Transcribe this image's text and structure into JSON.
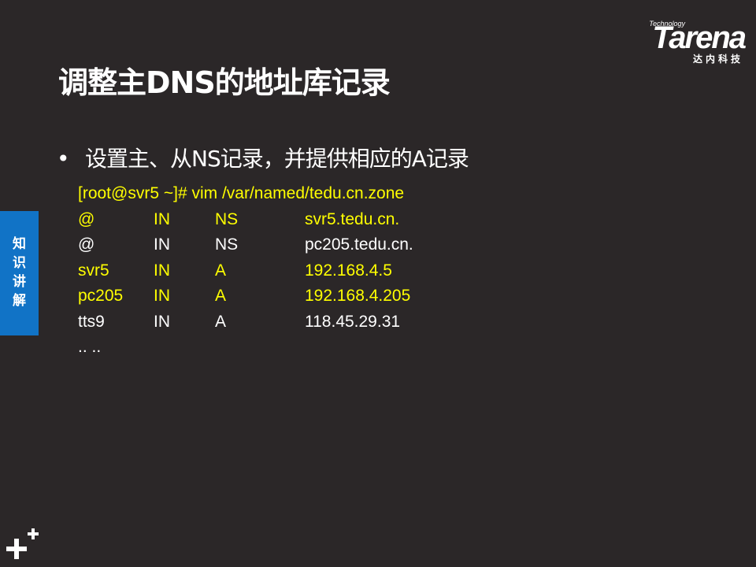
{
  "logo": {
    "technology": "Technology",
    "name": "Tarena",
    "chinese": "达内科技"
  },
  "slide": {
    "title": "调整主DNS的地址库记录",
    "side_tab": "知识讲解",
    "bullet": "设置主、从NS记录，并提供相应的A记录",
    "command": "[root@svr5 ~]# vim  /var/named/tedu.cn.zone",
    "records": [
      {
        "name": "@",
        "class": "IN",
        "type": "NS",
        "value": "svr5.tedu.cn.",
        "highlight": true
      },
      {
        "name": "@",
        "class": "IN",
        "type": "NS",
        "value": "pc205.tedu.cn.",
        "highlight": false
      },
      {
        "name": "svr5",
        "class": "IN",
        "type": "A",
        "value": "192.168.4.5",
        "highlight": true
      },
      {
        "name": "pc205",
        "class": "IN",
        "type": "A",
        "value": "192.168.4.205",
        "highlight": true
      },
      {
        "name": "tts9",
        "class": "IN",
        "type": "A",
        "value": "118.45.29.31",
        "highlight": false
      }
    ],
    "ellipsis": ".. .."
  },
  "colors": {
    "background": "#2b2728",
    "highlight": "#ffff00",
    "side_tab": "#1173c6"
  }
}
